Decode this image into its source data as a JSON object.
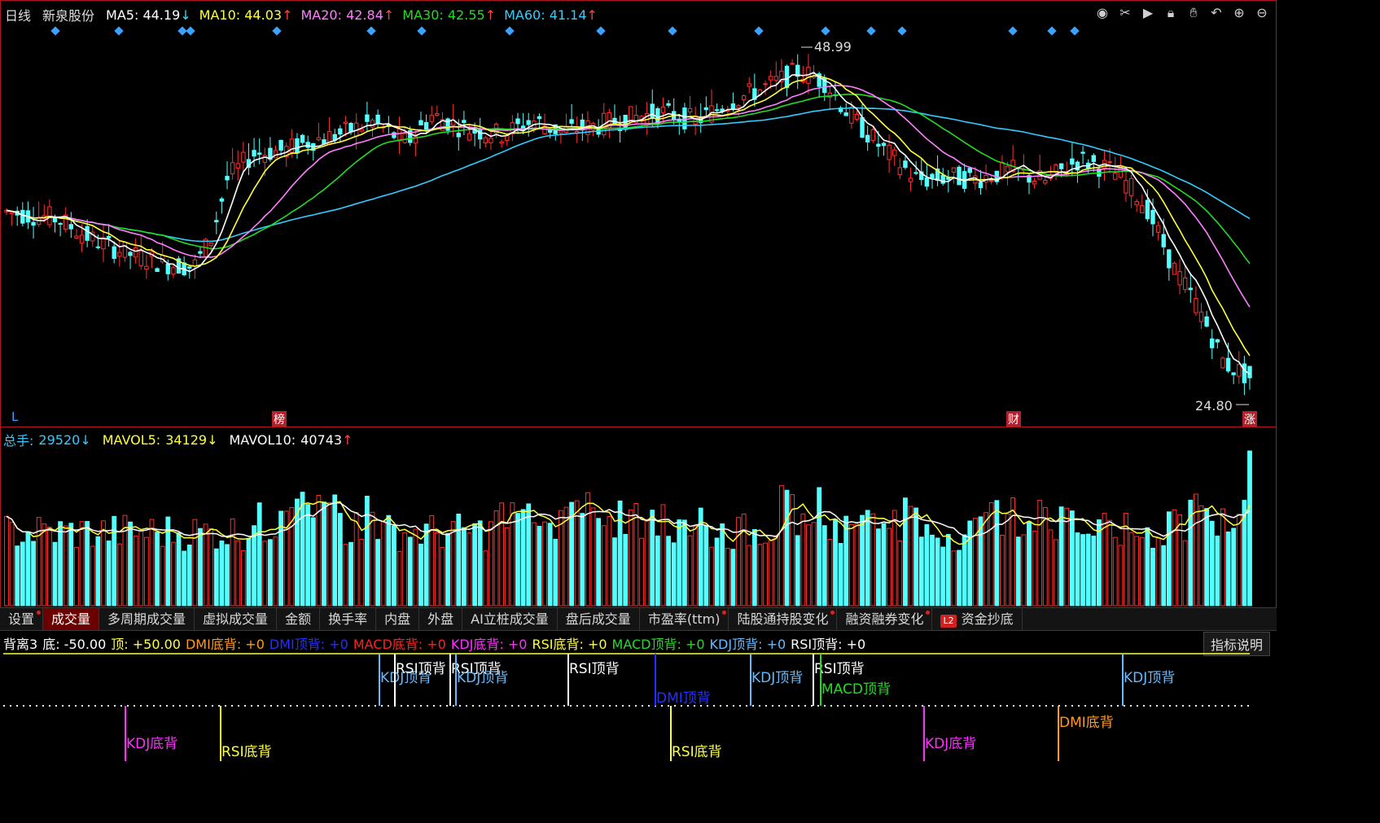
{
  "main": {
    "period": "日线",
    "stock_name": "新泉股份",
    "ma": [
      {
        "label": "MA5:",
        "value": "44.19",
        "arrow": "↓",
        "color": "#ffffff"
      },
      {
        "label": "MA10:",
        "value": "44.03",
        "arrow": "↑",
        "color": "#ffff3c"
      },
      {
        "label": "MA20:",
        "value": "42.84",
        "arrow": "↑",
        "color": "#ff7fff"
      },
      {
        "label": "MA30:",
        "value": "42.55",
        "arrow": "↑",
        "color": "#22dd22"
      },
      {
        "label": "MA60:",
        "value": "41.14",
        "arrow": "↑",
        "color": "#33ccff"
      }
    ],
    "high_label": "48.99",
    "low_label": "24.80",
    "left_tag": "L",
    "tag_bang": "榜",
    "tag_cai": "财",
    "tag_zhang": "涨",
    "icons": [
      "eye-icon",
      "scissors-icon",
      "play-icon",
      "lock-icon",
      "hand-icon",
      "undo-icon",
      "zoom-in-icon",
      "zoom-out-icon"
    ]
  },
  "volume": {
    "total": {
      "label": "总手:",
      "value": "29520",
      "arrow": "↓"
    },
    "mavol5": {
      "label": "MAVOL5:",
      "value": "34129",
      "arrow": "↓"
    },
    "mavol10": {
      "label": "MAVOL10:",
      "value": "40743",
      "arrow": "↑"
    }
  },
  "tabs": [
    {
      "label": "设置",
      "active": false,
      "dot": true
    },
    {
      "label": "成交量",
      "active": true,
      "dot": false
    },
    {
      "label": "多周期成交量",
      "active": false,
      "dot": false
    },
    {
      "label": "虚拟成交量",
      "active": false,
      "dot": false
    },
    {
      "label": "金额",
      "active": false,
      "dot": false
    },
    {
      "label": "换手率",
      "active": false,
      "dot": false
    },
    {
      "label": "内盘",
      "active": false,
      "dot": false
    },
    {
      "label": "外盘",
      "active": false,
      "dot": false
    },
    {
      "label": "AI立桩成交量",
      "active": false,
      "dot": false
    },
    {
      "label": "盘后成交量",
      "active": false,
      "dot": false
    },
    {
      "label": "市盈率(ttm)",
      "active": false,
      "dot": true
    },
    {
      "label": "陆股通持股变化",
      "active": false,
      "dot": true
    },
    {
      "label": "融资融券变化",
      "active": false,
      "dot": true
    },
    {
      "label": "资金抄底",
      "active": false,
      "dot": false,
      "badge": "L2"
    }
  ],
  "indicator": {
    "name": "背离3",
    "items": [
      {
        "label": "底:",
        "value": "-50.00",
        "color": "#ffffff",
        "vcolor": "#ffffff"
      },
      {
        "label": "顶:",
        "value": "+50.00",
        "color": "#ffff3c",
        "vcolor": "#ffff3c"
      },
      {
        "label": "DMI底背:",
        "value": "+0",
        "color": "#ff9a1f",
        "vcolor": "#ff9a1f"
      },
      {
        "label": "DMI顶背:",
        "value": "+0",
        "color": "#2430ff",
        "vcolor": "#2430ff"
      },
      {
        "label": "MACD底背:",
        "value": "+0",
        "color": "#ff2020",
        "vcolor": "#ff2020"
      },
      {
        "label": "KDJ底背:",
        "value": "+0",
        "color": "#ff30ff",
        "vcolor": "#ff30ff"
      },
      {
        "label": "RSI底背:",
        "value": "+0",
        "color": "#ffff3c",
        "vcolor": "#ffff3c"
      },
      {
        "label": "MACD顶背:",
        "value": "+0",
        "color": "#22dd22",
        "vcolor": "#22dd22"
      },
      {
        "label": "KDJ顶背:",
        "value": "+0",
        "color": "#66bbff",
        "vcolor": "#66bbff"
      },
      {
        "label": "RSI顶背:",
        "value": "+0",
        "color": "#ffffff",
        "vcolor": "#ffffff"
      }
    ],
    "help_button": "指标说明",
    "signals": [
      {
        "text": "KDJ底背",
        "color": "#ff30ff"
      },
      {
        "text": "RSI底背",
        "color": "#ffff3c"
      },
      {
        "text": "KDJ顶背",
        "color": "#66bbff"
      },
      {
        "text": "RSI顶背",
        "color": "#ffffff"
      },
      {
        "text": "RSI顶背",
        "color": "#ffffff"
      },
      {
        "text": "KDJ顶背",
        "color": "#66bbff"
      },
      {
        "text": "RSI顶背",
        "color": "#ffffff"
      },
      {
        "text": "DMI顶背",
        "color": "#2430ff"
      },
      {
        "text": "RSI底背",
        "color": "#ffff3c"
      },
      {
        "text": "KDJ顶背",
        "color": "#66bbff"
      },
      {
        "text": "RSI顶背",
        "color": "#ffffff"
      },
      {
        "text": "MACD顶背",
        "color": "#22dd22"
      },
      {
        "text": "KDJ底背",
        "color": "#ff30ff"
      },
      {
        "text": "DMI底背",
        "color": "#ff9a1f"
      },
      {
        "text": "KDJ顶背",
        "color": "#66bbff"
      }
    ]
  }
}
